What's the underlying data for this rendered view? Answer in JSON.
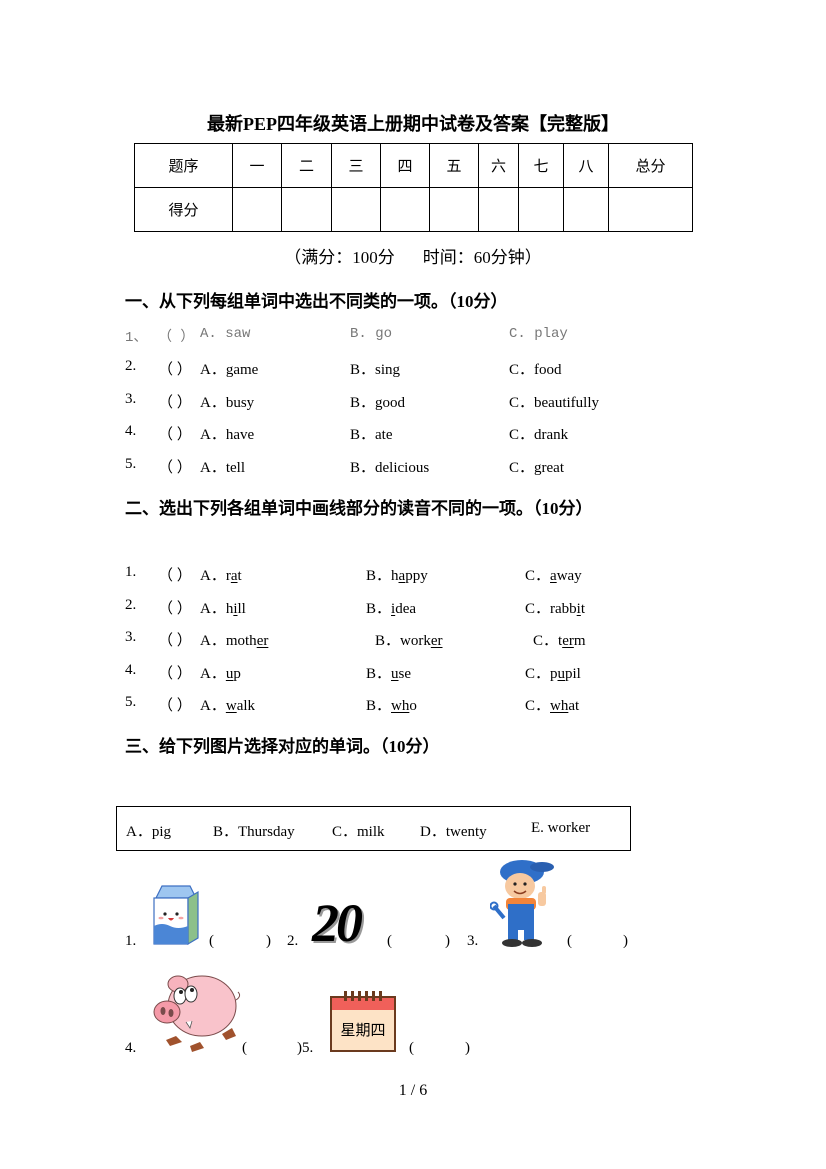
{
  "title": "最新PEP四年级英语上册期中试卷及答案【完整版】",
  "score_table": {
    "header_row": [
      "题序",
      "一",
      "二",
      "三",
      "四",
      "五",
      "六",
      "七",
      "八",
      "总分"
    ],
    "score_row_label": "得分"
  },
  "full_mark": {
    "score": "（满分：100分",
    "time": "时间：60分钟）"
  },
  "section1": {
    "heading": "一、从下列每组单词中选出不同类的一项。（10分）",
    "questions": [
      {
        "num": "1、",
        "paren": "（    ）",
        "a": "A. saw",
        "b": "B. go",
        "c": "C. play"
      },
      {
        "num": "2.",
        "paren": "（    ）",
        "a": "A．game",
        "b": "B．sing",
        "c": "C．food"
      },
      {
        "num": "3.",
        "paren": "（    ）",
        "a": "A．busy",
        "b": "B．good",
        "c": "C．beautifully"
      },
      {
        "num": "4.",
        "paren": "（    ）",
        "a": "A．have",
        "b": "B．ate",
        "c": "C．drank"
      },
      {
        "num": "5.",
        "paren": "（    ）",
        "a": "A．tell",
        "b": "B．delicious",
        "c": "C．great"
      }
    ]
  },
  "section2": {
    "heading": "二、选出下列各组单词中画线部分的读音不同的一项。（10分）",
    "questions": [
      {
        "num": "1.",
        "paren": "（    ）",
        "a": {
          "label": "A．",
          "pre": "r",
          "ul": "a",
          "post": "t"
        },
        "b": {
          "label": "B．",
          "pre": "h",
          "ul": "a",
          "post": "ppy"
        },
        "c": {
          "label": "C．",
          "pre": "",
          "ul": "a",
          "post": "way"
        }
      },
      {
        "num": "2.",
        "paren": "（    ）",
        "a": {
          "label": "A．",
          "pre": "h",
          "ul": "i",
          "post": "ll"
        },
        "b": {
          "label": "B．",
          "pre": "",
          "ul": "i",
          "post": "dea"
        },
        "c": {
          "label": "C．",
          "pre": "rabb",
          "ul": "i",
          "post": "t"
        }
      },
      {
        "num": "3.",
        "paren": "（    ）",
        "a": {
          "label": "A．",
          "pre": "moth",
          "ul": "er",
          "post": ""
        },
        "b": {
          "label": "B．",
          "pre": "work",
          "ul": "er",
          "post": ""
        },
        "c": {
          "label": "C．",
          "pre": "t",
          "ul": "er",
          "post": "m"
        }
      },
      {
        "num": "4.",
        "paren": "（    ）",
        "a": {
          "label": "A．",
          "pre": "",
          "ul": "u",
          "post": "p"
        },
        "b": {
          "label": "B．",
          "pre": "",
          "ul": "u",
          "post": "se"
        },
        "c": {
          "label": "C．",
          "pre": "p",
          "ul": "u",
          "post": "pil"
        }
      },
      {
        "num": "5.",
        "paren": "（    ）",
        "a": {
          "label": "A．",
          "pre": "",
          "ul": "w",
          "post": "alk"
        },
        "b": {
          "label": "B．",
          "pre": "",
          "ul": "wh",
          "post": "o"
        },
        "c": {
          "label": "C．",
          "pre": "",
          "ul": "wh",
          "post": "at"
        }
      }
    ]
  },
  "section3": {
    "heading": "三、给下列图片选择对应的单词。（10分）",
    "word_bank": [
      "A．pig",
      "B．Thursday",
      "C．milk",
      "D．twenty",
      "E. worker"
    ],
    "items": [
      {
        "num": "1.",
        "picture": "milk-carton",
        "paren_open": "(",
        "paren_close": ")"
      },
      {
        "num": "2.",
        "picture": "number-20",
        "number_text": "20",
        "paren_open": "(",
        "paren_close": ")"
      },
      {
        "num": "3.",
        "picture": "worker",
        "paren_open": "(",
        "paren_close": ")"
      },
      {
        "num": "4.",
        "picture": "pig",
        "paren_open": "(",
        "paren_close": ")"
      },
      {
        "num": ")5.",
        "picture": "calendar-thursday",
        "calendar_text": "星期四",
        "paren_open": "(",
        "paren_close": ")"
      }
    ]
  },
  "footer": {
    "page": "1 / 6"
  },
  "colors": {
    "text": "#000000",
    "muted_row": "#777777",
    "calendar_red": "#f0605a",
    "calendar_cream": "#fde3c6",
    "calendar_brown": "#6b3a1e"
  }
}
